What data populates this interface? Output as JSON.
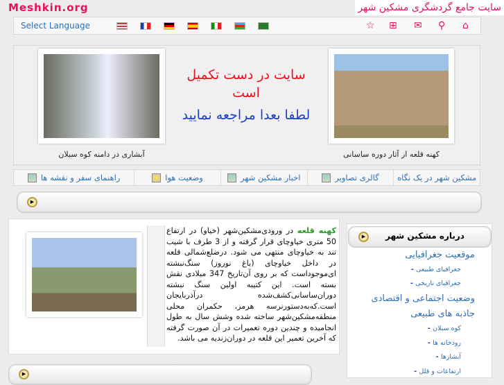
{
  "header": {
    "logo": "Meshkin.org",
    "site_title": "سایت جامع گردشگری مشکین شهر"
  },
  "toolbar": {
    "select_language": "Select Language",
    "flags": [
      "us-flag",
      "france-flag",
      "germany-flag",
      "spain-flag",
      "italy-flag",
      "azerbaijan-flag",
      "saudi-flag"
    ],
    "icons": [
      "favorite-icon",
      "sitemap-icon",
      "mail-icon",
      "search-icon",
      "home-icon"
    ]
  },
  "banner": {
    "left_caption": "آبشاری در دامنه کوه سبلان",
    "right_caption": "کهنه قلعه از آثار دوره ساسانی",
    "message_1": "سایت در دست تکمیل است",
    "message_2": "لطفا بعدا مراجعه نمایید"
  },
  "nav": [
    "مشکین شهر در یک نگاه",
    "گالری تصاویر",
    "اخبار مشکین شهر",
    "وضعیت هوا",
    "راهنمای سفر و نقشه ها"
  ],
  "article": {
    "title": "کهنه قلعه",
    "body": "در ورودی‌مشکین‌شهر (خیاو) در ارتفاع 50 متری خیاوچای قرار گرفته و از 3 طرف با شیب تند به خیاوچای منتهی می شود. درضلع‌شمالی قلعه در داخل خیاوچای (باغ نوروز) سنگ‌نبشته ای‌موجوداست که بر روی آن‌تاریخ 347 میلادی نقش بسته است. این کتیبه اولین سنگ نبشته دوران‌ساسانی‌کشف‌شده درآذربایجان است.که‌به‌دستورنرسه هرمز، حکمران محلی منطقه‌مشکین‌شهر ساخته شده وشش سال به طول انجامیده و چندین دوره تعمیرات در آن صورت گرفته که آخرین تعمیر این قلعه در دوران‌زندیه می باشد."
  },
  "sidebar": {
    "title": "درباره مشکین شهر",
    "items": [
      {
        "label": "موقعیت جغرافیایی",
        "level": 1
      },
      {
        "label": "جغرافیای طبیعی",
        "level": 2
      },
      {
        "label": "جغرافیای تاریخی",
        "level": 2
      },
      {
        "label": "وضعیت اجتماعی و اقتصادی",
        "level": 1
      },
      {
        "label": "جاذبه های طبیعی",
        "level": 1
      },
      {
        "label": "کوه سبلان",
        "level": 2
      },
      {
        "label": "رودخانه ها",
        "level": 2
      },
      {
        "label": "آبشارها",
        "level": 2
      },
      {
        "label": "ارتفاعات و قلل",
        "level": 2
      }
    ]
  }
}
